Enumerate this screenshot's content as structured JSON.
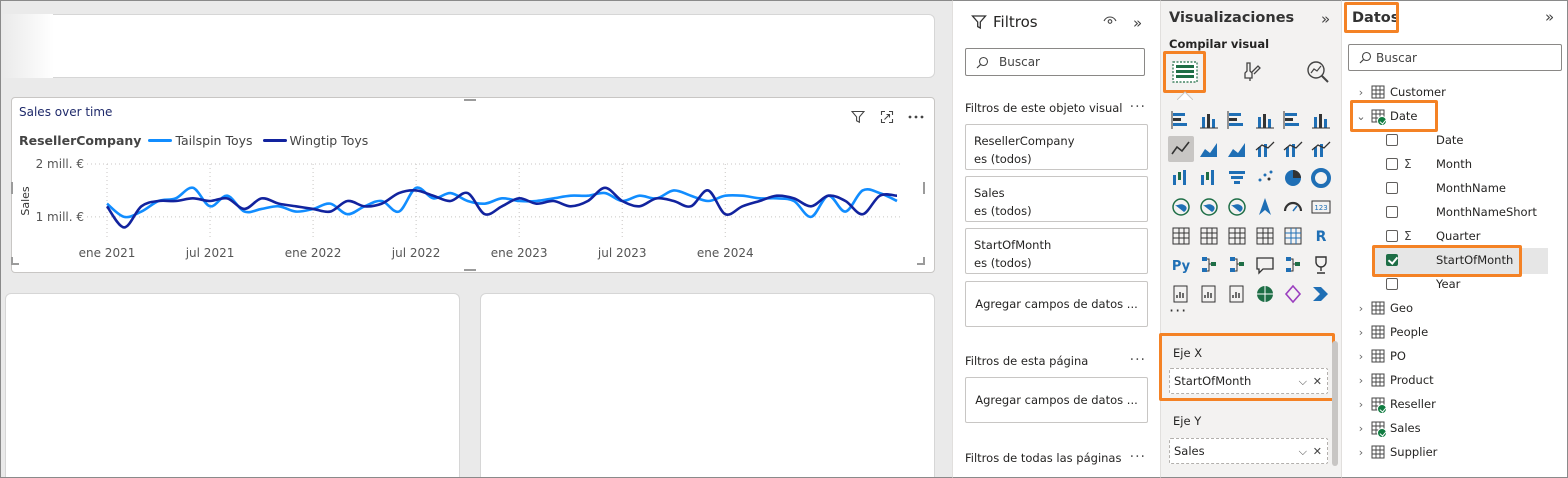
{
  "chart": {
    "title": "Sales over time",
    "legend_title": "ResellerCompany",
    "colors": {
      "tailspin": "#118dff",
      "wingtip": "#12239e"
    }
  },
  "chart_data": {
    "type": "line",
    "title": "Sales over time",
    "xlabel": "",
    "ylabel": "Sales",
    "y_ticks": [
      "2 mill. €",
      "1 mill. €"
    ],
    "x_ticks": [
      "ene 2021",
      "jul 2021",
      "ene 2022",
      "jul 2022",
      "ene 2023",
      "jul 2023",
      "ene 2024"
    ],
    "ylim": [
      0.6,
      2.0
    ],
    "legend_title": "ResellerCompany",
    "legend_position": "top-left",
    "grid": true,
    "x_start": "2021-01",
    "series": [
      {
        "name": "Tailspin Toys",
        "color": "#118dff",
        "values": [
          1.25,
          1.0,
          1.1,
          1.3,
          1.35,
          1.55,
          1.2,
          1.4,
          1.1,
          1.15,
          1.2,
          1.1,
          1.15,
          1.25,
          1.05,
          1.2,
          1.3,
          1.1,
          1.55,
          1.35,
          1.45,
          1.3,
          1.25,
          1.35,
          1.3,
          1.3,
          1.35,
          1.4,
          1.4,
          1.45,
          1.3,
          1.4,
          1.35,
          1.5,
          1.4,
          1.3,
          1.4,
          1.4,
          1.35,
          1.35,
          1.3,
          1.0,
          1.4,
          1.1,
          1.5,
          1.45,
          1.3
        ]
      },
      {
        "name": "Wingtip Toys",
        "color": "#12239e",
        "values": [
          1.2,
          0.8,
          1.2,
          1.3,
          1.3,
          1.35,
          1.3,
          1.35,
          1.15,
          1.35,
          1.25,
          1.2,
          1.15,
          1.1,
          1.3,
          1.2,
          1.25,
          1.45,
          1.5,
          1.4,
          1.3,
          1.45,
          1.05,
          1.2,
          1.35,
          1.25,
          1.3,
          1.2,
          1.3,
          1.55,
          1.3,
          1.2,
          1.35,
          1.3,
          1.2,
          1.5,
          1.05,
          1.2,
          1.3,
          1.4,
          1.35,
          1.2,
          1.4,
          1.3,
          1.05,
          1.4,
          1.4
        ]
      }
    ]
  },
  "filters": {
    "title": "Filtros",
    "search_placeholder": "Buscar",
    "visual_section": "Filtros de este objeto visual",
    "cards": [
      {
        "field": "ResellerCompany",
        "state": "es (todos)"
      },
      {
        "field": "Sales",
        "state": "es (todos)"
      },
      {
        "field": "StartOfMonth",
        "state": "es (todos)"
      }
    ],
    "add_fields": "Agregar campos de datos ...",
    "page_section": "Filtros de esta página",
    "all_pages_section": "Filtros de todas las páginas"
  },
  "viz": {
    "title": "Visualizaciones",
    "build_label": "Compilar visual",
    "x_axis_label": "Eje X",
    "x_axis_field": "StartOfMonth",
    "y_axis_label": "Eje Y",
    "y_axis_field": "Sales",
    "accent": "#f48225"
  },
  "data_pane": {
    "title": "Datos",
    "search_placeholder": "Buscar",
    "tables": [
      "Customer",
      "Date",
      "Geo",
      "People",
      "PO",
      "Product",
      "Reseller",
      "Sales",
      "Supplier"
    ],
    "date_fields": [
      {
        "name": "Date",
        "sigma": false,
        "checked": false
      },
      {
        "name": "Month",
        "sigma": true,
        "checked": false
      },
      {
        "name": "MonthName",
        "sigma": false,
        "checked": false
      },
      {
        "name": "MonthNameShort",
        "sigma": false,
        "checked": false
      },
      {
        "name": "Quarter",
        "sigma": true,
        "checked": false
      },
      {
        "name": "StartOfMonth",
        "sigma": false,
        "checked": true
      },
      {
        "name": "Year",
        "sigma": false,
        "checked": false
      }
    ]
  }
}
